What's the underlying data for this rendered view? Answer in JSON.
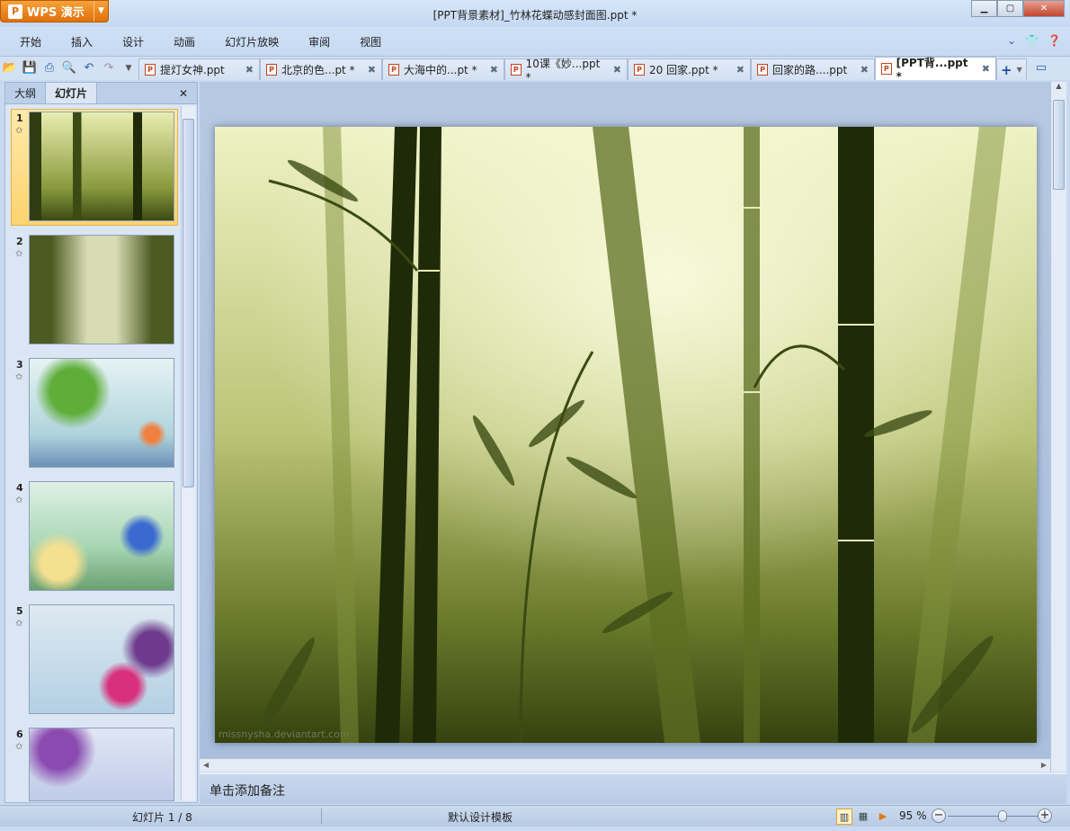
{
  "app": {
    "button_label": "WPS 演示",
    "title": "[PPT背景素材]_竹林花蝶动感封面图.ppt *"
  },
  "menu": [
    "开始",
    "插入",
    "设计",
    "动画",
    "幻灯片放映",
    "审阅",
    "视图"
  ],
  "tabs": [
    {
      "label": "提灯女神.ppt",
      "active": false
    },
    {
      "label": "北京的色...pt *",
      "active": false
    },
    {
      "label": "大海中的...pt *",
      "active": false
    },
    {
      "label": "10课《妙...ppt *",
      "active": false
    },
    {
      "label": "20 回家.ppt *",
      "active": false
    },
    {
      "label": "回家的路....ppt",
      "active": false
    },
    {
      "label": "[PPT背...ppt *",
      "active": true
    }
  ],
  "panel": {
    "tabs": [
      "大纲",
      "幻灯片"
    ],
    "active_tab": "幻灯片",
    "slides": [
      "1",
      "2",
      "3",
      "4",
      "5",
      "6"
    ],
    "selected": 1
  },
  "slide": {
    "watermark": "missnysha.deviantart.com"
  },
  "notes": {
    "placeholder": "单击添加备注"
  },
  "status": {
    "slide_counter": "幻灯片 1 / 8",
    "template": "默认设计模板",
    "zoom": "95 %",
    "zoom_percent": 95
  },
  "colors": {
    "accent": "#e0700b",
    "selected_thumb": "#fcd36f"
  }
}
